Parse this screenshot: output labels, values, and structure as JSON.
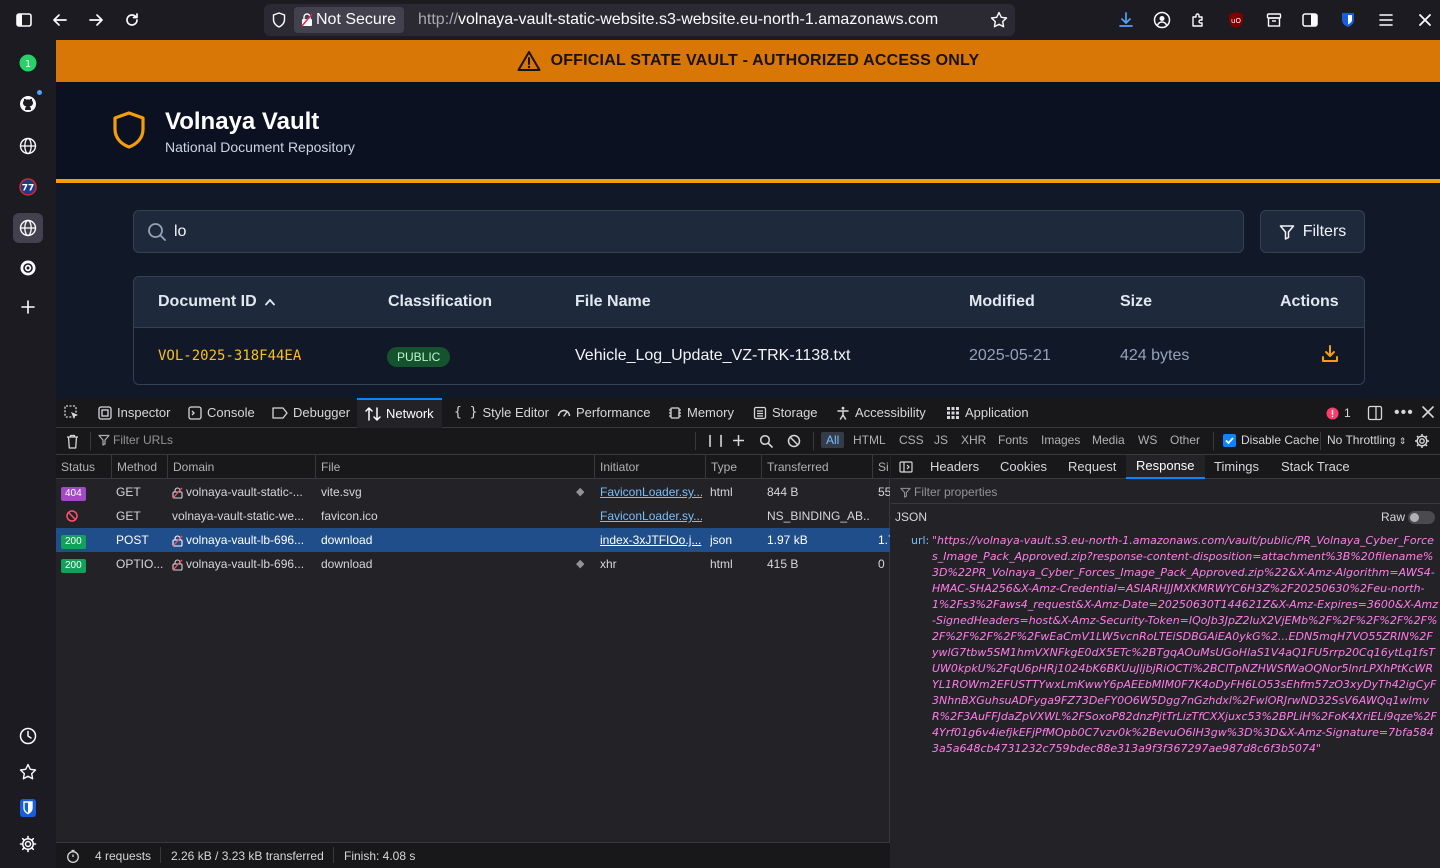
{
  "browser": {
    "not_secure_label": "Not Secure",
    "url_prefix": "http://",
    "url_host": "volnaya-vault-static-website.s3-website.eu-north-1.amazonaws.com"
  },
  "site": {
    "banner_text": "OFFICIAL STATE VAULT - AUTHORIZED ACCESS ONLY",
    "brand_title": "Volnaya Vault",
    "brand_subtitle": "National Document Repository",
    "search_value": "lo",
    "filters_label": "Filters",
    "table": {
      "headers": [
        "Document ID",
        "Classification",
        "File Name",
        "Modified",
        "Size",
        "Actions"
      ],
      "sort_indicator": "^",
      "row": {
        "doc_id": "VOL-2025-318F44EA",
        "classification": "PUBLIC",
        "file_name": "Vehicle_Log_Update_VZ-TRK-1138.txt",
        "modified": "2025-05-21",
        "size": "424 bytes"
      }
    }
  },
  "devtools": {
    "tabs": [
      "Inspector",
      "Console",
      "Debugger",
      "Network",
      "Style Editor",
      "Performance",
      "Memory",
      "Storage",
      "Accessibility",
      "Application"
    ],
    "active_tab": "Network",
    "error_count": "1",
    "filter_placeholder": "Filter URLs",
    "type_filters": [
      "All",
      "HTML",
      "CSS",
      "JS",
      "XHR",
      "Fonts",
      "Images",
      "Media",
      "WS",
      "Other"
    ],
    "disable_cache_label": "Disable Cache",
    "throttling_label": "No Throttling",
    "columns": [
      "Status",
      "Method",
      "Domain",
      "File",
      "Initiator",
      "Type",
      "Transferred",
      "Si"
    ],
    "requests": [
      {
        "status": "404",
        "method": "GET",
        "domain": "volnaya-vault-static-...",
        "file": "vite.svg",
        "initiator": "FaviconLoader.sy...",
        "type": "html",
        "transferred": "844 B",
        "size": "55"
      },
      {
        "status": "",
        "method": "GET",
        "domain": "volnaya-vault-static-we...",
        "file": "favicon.ico",
        "initiator": "FaviconLoader.sy...",
        "type": "",
        "transferred": "NS_BINDING_AB...",
        "size": ""
      },
      {
        "status": "200",
        "method": "POST",
        "domain": "volnaya-vault-lb-696...",
        "file": "download",
        "initiator": "index-3xJTFIOo.j...",
        "type": "json",
        "transferred": "1.97 kB",
        "size": "1.7"
      },
      {
        "status": "200",
        "method": "OPTIO...",
        "domain": "volnaya-vault-lb-696...",
        "file": "download",
        "initiator": "xhr",
        "type": "html",
        "transferred": "415 B",
        "size": "0"
      }
    ],
    "summary": {
      "requests": "4 requests",
      "transferred": "2.26 kB / 3.23 kB transferred",
      "finish": "Finish: 4.08 s"
    },
    "detail": {
      "tabs": [
        "Headers",
        "Cookies",
        "Request",
        "Response",
        "Timings",
        "Stack Trace"
      ],
      "active_tab": "Response",
      "filter_placeholder": "Filter properties",
      "json_label": "JSON",
      "raw_label": "Raw",
      "key": "url:",
      "url_value": "\"https://volnaya-vault.s3.eu-north-1.amazonaws.com/vault/public/PR_Volnaya_Cyber_Forces_Image_Pack_Approved.zip?response-content-disposition=attachment%3B%20filename%3D%22PR_Volnaya_Cyber_Forces_Image_Pack_Approved.zip%22&X-Amz-Algorithm=AWS4-HMAC-SHA256&X-Amz-Credential=ASIARHJJMXKMRWYC6H3Z%2F20250630%2Feu-north-1%2Fs3%2Faws4_request&X-Amz-Date=20250630T144621Z&X-Amz-Expires=3600&X-Amz-SignedHeaders=host&X-Amz-Security-Token=IQoJb3JpZ2luX2VjEMb%2F%2F%2F%2F%2F%2F%2F%2F%2F%2FwEaCmV1LW5vcnRoLTEiSDBGAiEA0ykG%2...EDN5mqH7VO55ZRIN%2FywlG7tbw5SM1hmVXNFkgE0dX5ETc%2BTgqAOuMsUGoHlaS1V4aQ1FU5rrp20Cq16ytLq1fsTUW0kpkU%2FqU6pHRj1024bK6BKUuJljbjRiOCTi%2BClTpNZHWSfWaOQNor5lnrLPXhPtKcWRYL1ROWm2EFUSTTYwxLmKwwY6pAEEbMIM0F7K4oDyFH6LO53sEhfm57zO3xyDyTh42igCyF3NhnBXGuhsuADFyga9FZ73DeFY0O6W5Dgg7nGzhdxl%2FwlORJrwND32SsV6AWQq1wlmvR%2F3AuFFJdaZpVXWL%2FSoxoP82dnzPjtTrLizTfCXXjuxc53%2BPLiH%2FoK4XriELi9qze%2F4Yrf01g6v4iefjkEFjPfMOpb0C7vzv0k%2BevuO6lH3gw%3D%3D&X-Amz-Signature=7bfa5843a5a648cb4731232c759bdec88e313a9f3f367297ae987d8c6f3b5074\""
    }
  },
  "colors": {
    "banner": "#d97706",
    "accent": "#f59e0b",
    "devtools_accent": "#0a84ff",
    "json_string": "#ff7de9"
  },
  "icons": [
    "sidebar-toggle-icon",
    "back-icon",
    "forward-icon",
    "reload-icon",
    "shield-icon",
    "lock-icon",
    "star-icon",
    "download-icon",
    "account-icon",
    "extensions-icon",
    "ublock-icon",
    "container-icon",
    "reader-icon",
    "bitwarden-icon",
    "menu-icon",
    "close-icon",
    "warning-icon",
    "search-icon",
    "filter-icon",
    "trash-icon"
  ]
}
